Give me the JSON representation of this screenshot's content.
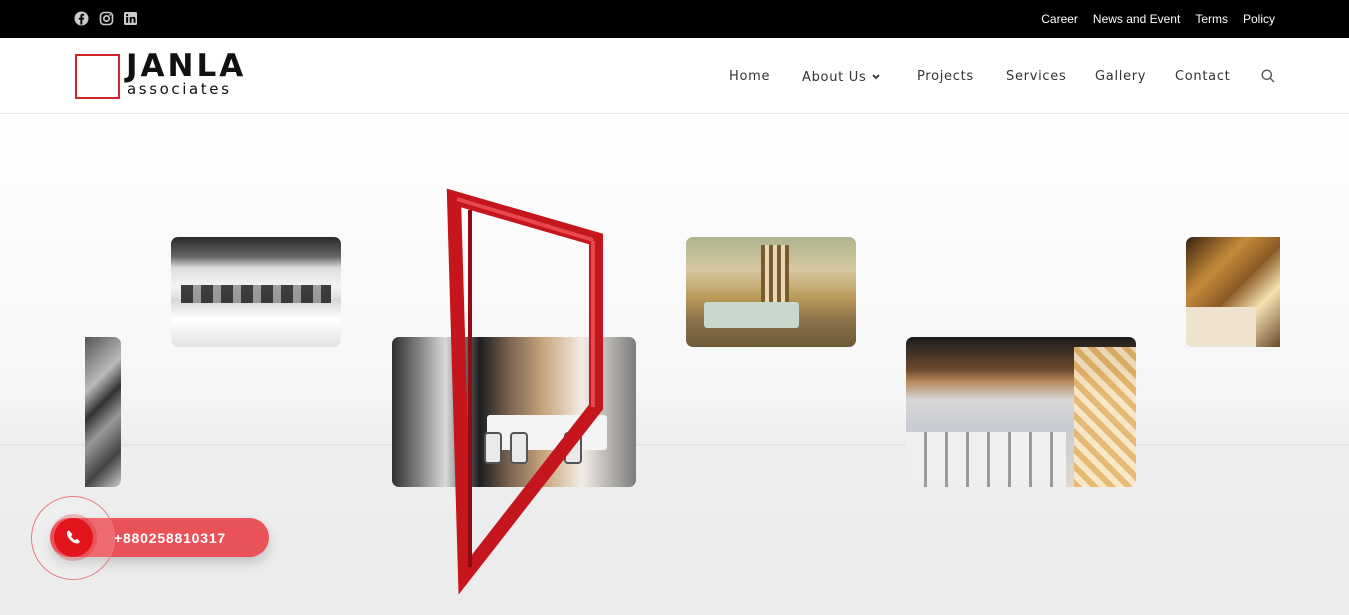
{
  "topbar": {
    "social": [
      "facebook-icon",
      "instagram-icon",
      "linkedin-icon"
    ],
    "links": [
      "Career",
      "News and Event",
      "Terms",
      "Policy"
    ]
  },
  "logo": {
    "title": "JANLA",
    "subtitle": "associates"
  },
  "nav": {
    "items": [
      "Home",
      "About Us",
      "Projects",
      "Services",
      "Gallery",
      "Contact"
    ],
    "search_icon": "search-icon"
  },
  "call": {
    "phone": "+880258810317",
    "icon": "phone-icon"
  },
  "colors": {
    "accent": "#d0232a",
    "call_bg": "#ea5259",
    "topbar_bg": "#000000"
  }
}
